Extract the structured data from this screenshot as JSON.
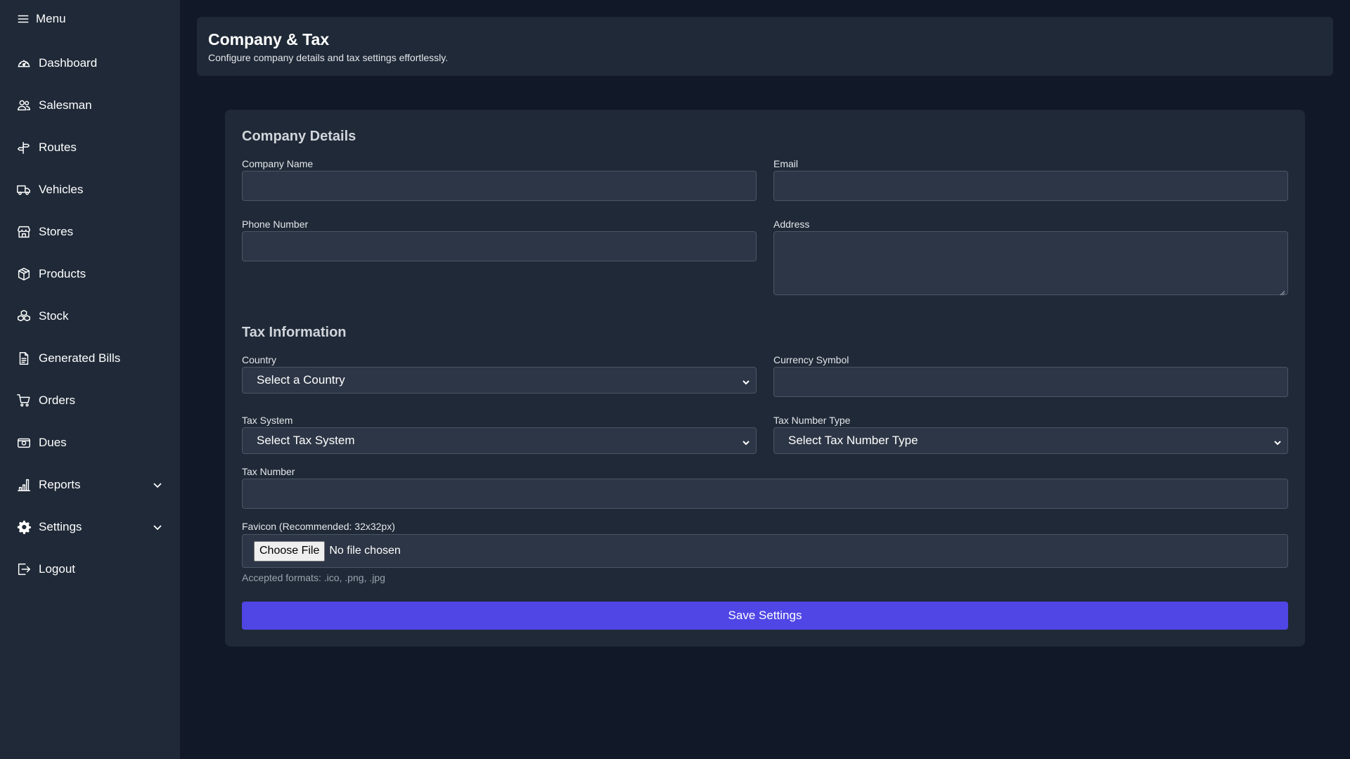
{
  "sidebar": {
    "menu_label": "Menu",
    "items": [
      {
        "label": "Dashboard",
        "icon": "gauge-icon"
      },
      {
        "label": "Salesman",
        "icon": "users-icon"
      },
      {
        "label": "Routes",
        "icon": "signpost-icon"
      },
      {
        "label": "Vehicles",
        "icon": "truck-icon"
      },
      {
        "label": "Stores",
        "icon": "store-icon"
      },
      {
        "label": "Products",
        "icon": "box-icon"
      },
      {
        "label": "Stock",
        "icon": "boxes-icon"
      },
      {
        "label": "Generated Bills",
        "icon": "document-icon"
      },
      {
        "label": "Orders",
        "icon": "cart-icon"
      },
      {
        "label": "Dues",
        "icon": "cash-icon"
      },
      {
        "label": "Reports",
        "icon": "bar-chart-icon"
      },
      {
        "label": "Settings",
        "icon": "gear-icon"
      },
      {
        "label": "Logout",
        "icon": "logout-icon"
      }
    ]
  },
  "header": {
    "title": "Company & Tax",
    "subtitle": "Configure company details and tax settings effortlessly."
  },
  "company": {
    "section_title": "Company Details",
    "company_name_label": "Company Name",
    "company_name_value": "",
    "email_label": "Email",
    "email_value": "",
    "phone_label": "Phone Number",
    "phone_value": "",
    "address_label": "Address",
    "address_value": ""
  },
  "tax": {
    "section_title": "Tax Information",
    "country_label": "Country",
    "country_selected": "Select a Country",
    "currency_label": "Currency Symbol",
    "currency_value": "",
    "tax_system_label": "Tax System",
    "tax_system_selected": "Select Tax System",
    "tax_number_type_label": "Tax Number Type",
    "tax_number_type_selected": "Select Tax Number Type",
    "tax_number_label": "Tax Number",
    "tax_number_value": ""
  },
  "favicon": {
    "label": "Favicon (Recommended: 32x32px)",
    "button_label": "Choose File",
    "file_status": "No file chosen",
    "hint": "Accepted formats: .ico, .png, .jpg"
  },
  "actions": {
    "save_label": "Save Settings"
  },
  "colors": {
    "page_bg": "#111827",
    "panel_bg": "#1f2937",
    "input_bg": "#2d3646",
    "accent": "#4f46e5"
  }
}
